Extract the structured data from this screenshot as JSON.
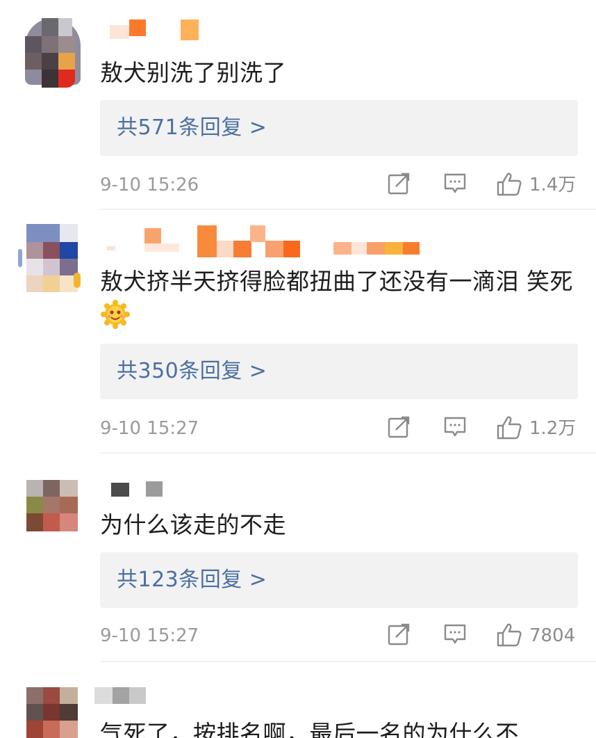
{
  "comments": [
    {
      "text": "敖犬别洗了别洗了",
      "reply_label": "共571条回复 >",
      "time": "9-10 15:26",
      "likes": "1.4万",
      "icons": [
        "repost-icon",
        "comment-icon",
        "thumbs-up-icon"
      ]
    },
    {
      "text": "敖犬挤半天挤得脸都扭曲了还没有一滴泪 笑死",
      "reply_label": "共350条回复 >",
      "time": "9-10 15:27",
      "likes": "1.2万",
      "icons": [
        "repost-icon",
        "comment-icon",
        "thumbs-up-icon"
      ]
    },
    {
      "text": "为什么该走的不走",
      "reply_label": "共123条回复 >",
      "time": "9-10 15:27",
      "likes": "7804",
      "icons": [
        "repost-icon",
        "comment-icon",
        "thumbs-up-icon"
      ]
    },
    {
      "text": "气死了，按排名啊，最后一名的为什么不"
    }
  ],
  "colors": {
    "reply_link": "#4a6fa3",
    "reply_bg": "#f2f2f2",
    "meta_gray": "#9a9a9a",
    "text": "#1d1d1d"
  }
}
